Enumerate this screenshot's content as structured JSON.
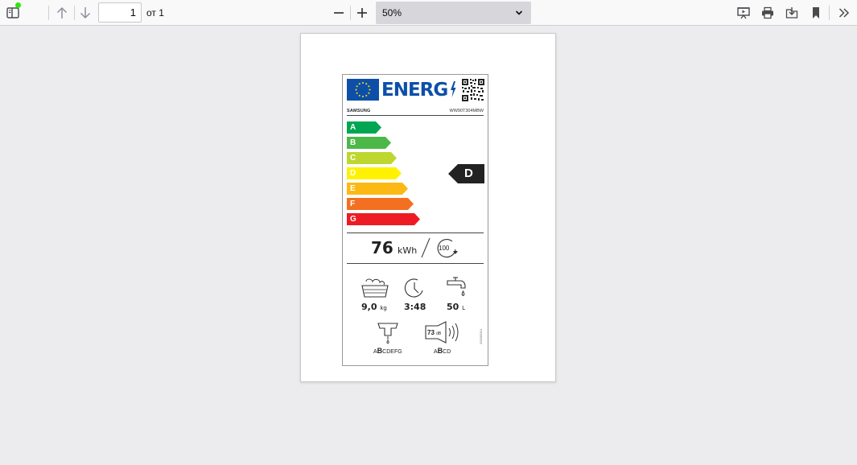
{
  "toolbar": {
    "page_number": "1",
    "page_count": "от 1",
    "zoom_value": "50%",
    "icons": [
      "sidebar-toggle-icon",
      "previous-page-icon",
      "next-page-icon",
      "zoom-out-icon",
      "zoom-in-icon",
      "presentation-mode-icon",
      "print-icon",
      "save-icon",
      "bookmark-icon",
      "tools-icon"
    ],
    "notification_dot_color": "#30e60b"
  },
  "energy_label": {
    "header_text": "ENERG",
    "brand": "SAMSUNG",
    "model": "WW90T304MBW",
    "classes": [
      "A",
      "B",
      "C",
      "D",
      "E",
      "F",
      "G"
    ],
    "class_colors": [
      "#00a651",
      "#4cb847",
      "#bed630",
      "#fff200",
      "#fdb913",
      "#f37021",
      "#ed1c24"
    ],
    "rated_class": "D",
    "energy_value": "76",
    "energy_unit": "kWh",
    "cycles": "100",
    "capacity_value": "9,0",
    "capacity_unit": "kg",
    "duration_value": "3:48",
    "water_value": "50",
    "water_unit": "L",
    "spin_scale_prefix": "A",
    "spin_scale_active": "B",
    "spin_scale_suffix": "CDEFG",
    "noise_value": "73",
    "noise_unit": "dB",
    "noise_scale_prefix": "A",
    "noise_scale_active": "B",
    "noise_scale_suffix": "CD",
    "regulation": "2019/2014"
  }
}
